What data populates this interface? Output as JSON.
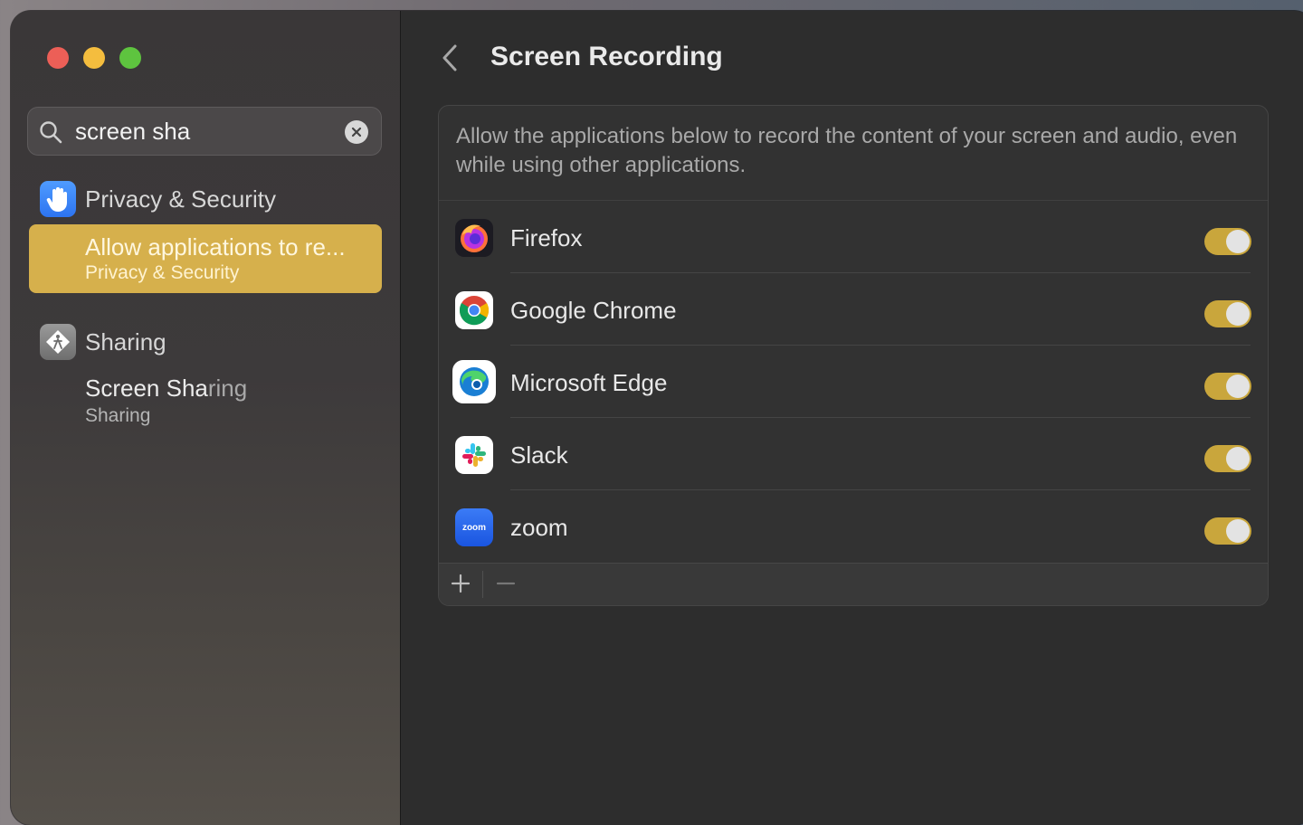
{
  "sidebar": {
    "search": {
      "value": "screen sha",
      "placeholder": "Search"
    },
    "groups": [
      {
        "label": "Privacy & Security",
        "icon": "hand-raised-icon",
        "results": [
          {
            "title": "Allow applications to re...",
            "subtitle": "Privacy & Security",
            "selected": true
          }
        ]
      },
      {
        "label": "Sharing",
        "icon": "sharing-icon",
        "results": [
          {
            "title_match": "Screen Sha",
            "title_rest": "ring",
            "subtitle": "Sharing",
            "selected": false
          }
        ]
      }
    ]
  },
  "main": {
    "title": "Screen Recording",
    "description": "Allow the applications below to record the content of your screen and audio, even while using other applications.",
    "apps": [
      {
        "name": "Firefox",
        "icon": "firefox-icon",
        "enabled": true
      },
      {
        "name": "Google Chrome",
        "icon": "chrome-icon",
        "enabled": true
      },
      {
        "name": "Microsoft Edge",
        "icon": "edge-icon",
        "enabled": true
      },
      {
        "name": "Slack",
        "icon": "slack-icon",
        "enabled": true
      },
      {
        "name": "zoom",
        "icon": "zoom-icon",
        "enabled": true,
        "icon_text": "zoom"
      }
    ]
  },
  "colors": {
    "accent": "#d6b04c",
    "toggle_on": "#c9a63c",
    "window_bg": "#2d2d2d"
  }
}
